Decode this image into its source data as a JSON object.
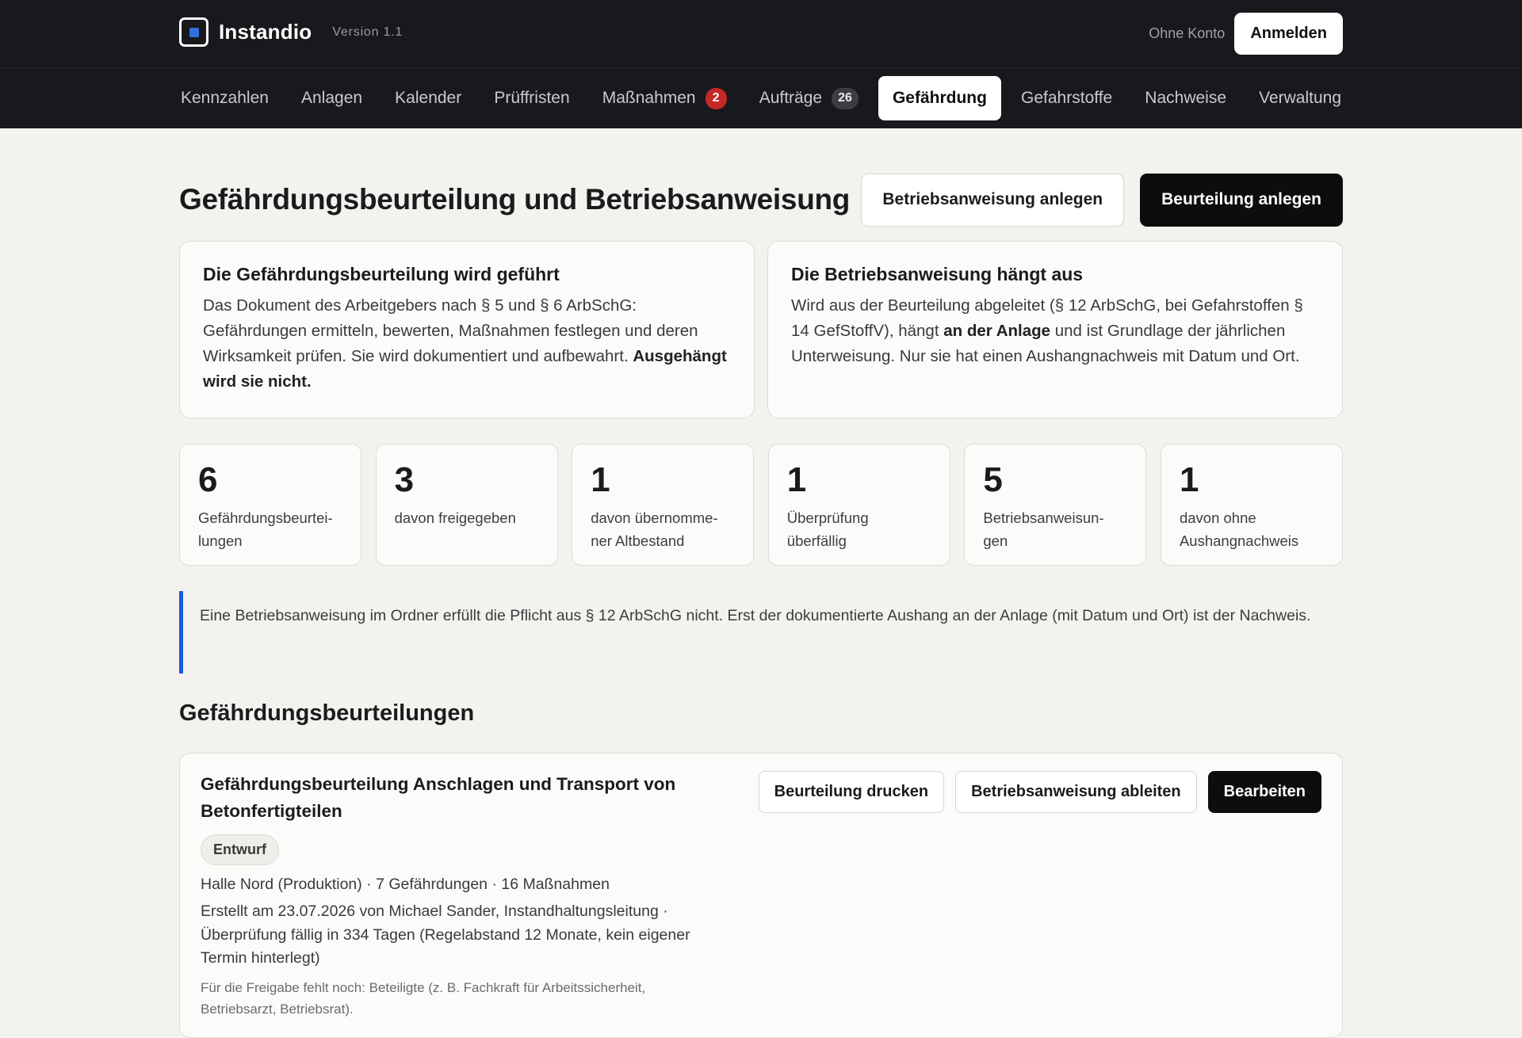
{
  "app": {
    "name": "Instandio",
    "version": "Version 1.1",
    "account_status": "Ohne Konto",
    "login_label": "Anmelden",
    "accent_color": "#2f6fe0"
  },
  "nav": {
    "items": [
      {
        "label": "Kennzahlen"
      },
      {
        "label": "Anlagen"
      },
      {
        "label": "Kalender"
      },
      {
        "label": "Prüffristen"
      },
      {
        "label": "Maßnahmen",
        "badge": "2"
      },
      {
        "label": "Aufträge",
        "badge": "26"
      },
      {
        "label": "Gefährdung",
        "active": true
      },
      {
        "label": "Gefahrstoffe"
      },
      {
        "label": "Nachweise"
      },
      {
        "label": "Verwaltung"
      }
    ]
  },
  "page": {
    "title": "Gefährdungsbeurteilung und Betriebsanweisung",
    "create_instruction_label": "Betriebsanweisung anlegen",
    "create_assessment_label": "Beurteilung anlegen"
  },
  "info_cards": [
    {
      "title": "Die Gefährdungsbeurteilung wird geführt",
      "text": "Das Dokument des Arbeitgebers nach § 5 und § 6 ArbSchG: Gefährdungen ermitteln, bewerten, Maßnahmen festlegen und deren Wirksamkeit prüfen. Sie wird dokumentiert und aufbewahrt.",
      "emphasis": "Ausgehängt wird sie nicht."
    },
    {
      "title": "Die Betriebsanweisung hängt aus",
      "text_before": "Wird aus der Beurteilung abgeleitet (§ 12 ArbSchG, bei Gefahrstoffen § 14 GefStoffV), hängt",
      "emphasis": "an der Anlage",
      "text_after": "und ist Grundlage der jährlichen Unterweisung. Nur sie hat einen Aushangnachweis mit Datum und Ort."
    }
  ],
  "stats": [
    {
      "value": "6",
      "label": "Gefährdungsbeurtei-lungen"
    },
    {
      "value": "3",
      "label": "davon freigegeben"
    },
    {
      "value": "1",
      "label": "davon übernomme-ner Altbestand"
    },
    {
      "value": "1",
      "label": "Überprüfung überfällig"
    },
    {
      "value": "5",
      "label": "Betriebsanweisun-gen"
    },
    {
      "value": "1",
      "label": "davon ohne Aushangnachweis"
    }
  ],
  "callout": {
    "text": "Eine Betriebsanweisung im Ordner erfüllt die Pflicht aus § 12 ArbSchG nicht. Erst der dokumentierte Aushang an der Anlage (mit Datum und Ort) ist der Nachweis."
  },
  "assessments": {
    "section_title": "Gefährdungsbeurteilungen",
    "items": [
      {
        "title": "Gefährdungsbeurteilung Anschlagen und Transport von Betonfertigteilen",
        "status": "Entwurf",
        "meta": "Halle Nord (Produktion) · 7 Gefährdungen · 16 Maßnahmen",
        "created": "Erstellt am 23.07.2026 von Michael Sander, Instandhaltungsleitung · Überprüfung fällig in 334 Tagen (Regelabstand 12 Monate, kein eigener Termin hinterlegt)",
        "missing": "Für die Freigabe fehlt noch: Beteiligte (z. B. Fachkraft für Arbeitssicherheit, Betriebsarzt, Betriebsrat).",
        "print_label": "Beurteilung drucken",
        "derive_label": "Betriebsanweisung ableiten",
        "edit_label": "Bearbeiten"
      }
    ]
  }
}
